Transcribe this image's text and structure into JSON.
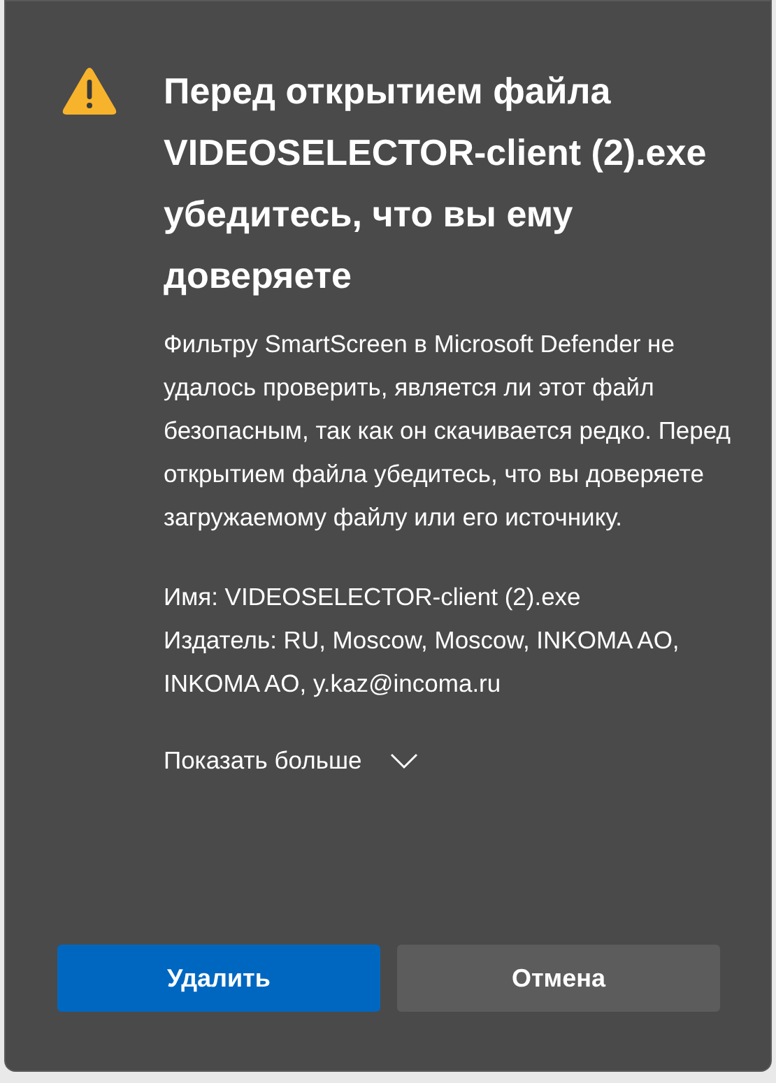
{
  "dialog": {
    "title": "Перед открытием файла VIDEOSELECTOR-client (2).exe убедитесь, что вы ему доверяете",
    "description": "Фильтру SmartScreen в Microsoft Defender не удалось проверить, является ли этот файл безопасным, так как он скачивается редко. Перед открытием файла убедитесь, что вы доверяете загружаемому файлу или его источнику.",
    "details": [
      "Имя: VIDEOSELECTOR-client (2).exe",
      "Издатель: RU, Moscow, Moscow, INKOMA AO, INKOMA AO, y.kaz@incoma.ru"
    ],
    "show_more": {
      "label": "Показать больше",
      "expanded": false
    },
    "buttons": [
      {
        "label": "Удалить",
        "kind": "primary"
      },
      {
        "label": "Отмена",
        "kind": "secondary"
      }
    ]
  }
}
